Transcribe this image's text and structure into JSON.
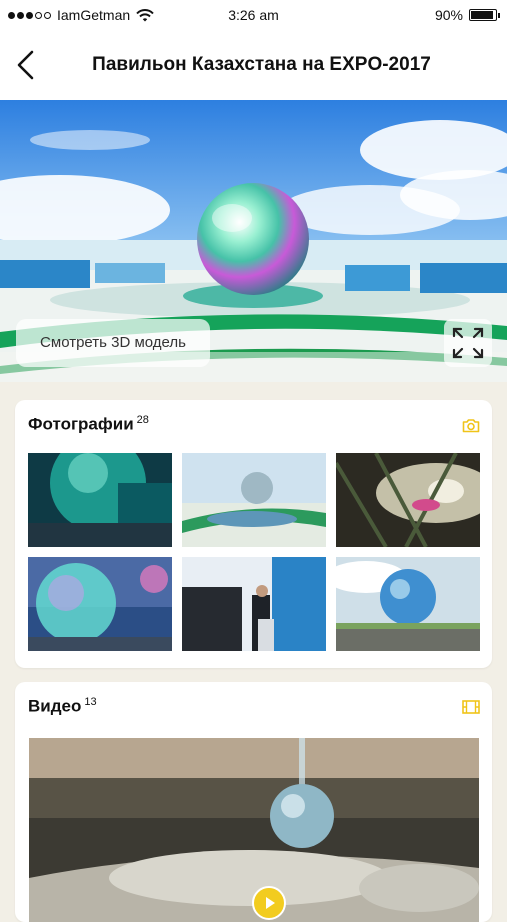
{
  "status_bar": {
    "carrier": "IamGetman",
    "time": "3:26 am",
    "battery": "90%",
    "battery_level": 0.9
  },
  "header": {
    "title": "Павильон Казахстана на EXPO-2017",
    "back_icon": "chevron-left-icon"
  },
  "hero": {
    "view_3d_label": "Смотреть 3D модель",
    "expand_icon": "fullscreen-icon"
  },
  "photos": {
    "title": "Фотографии",
    "count": "28",
    "icon": "camera-icon",
    "accent": "#f0c419"
  },
  "videos": {
    "title": "Видео",
    "count": "13",
    "icon": "film-icon",
    "play_icon": "play-icon"
  }
}
